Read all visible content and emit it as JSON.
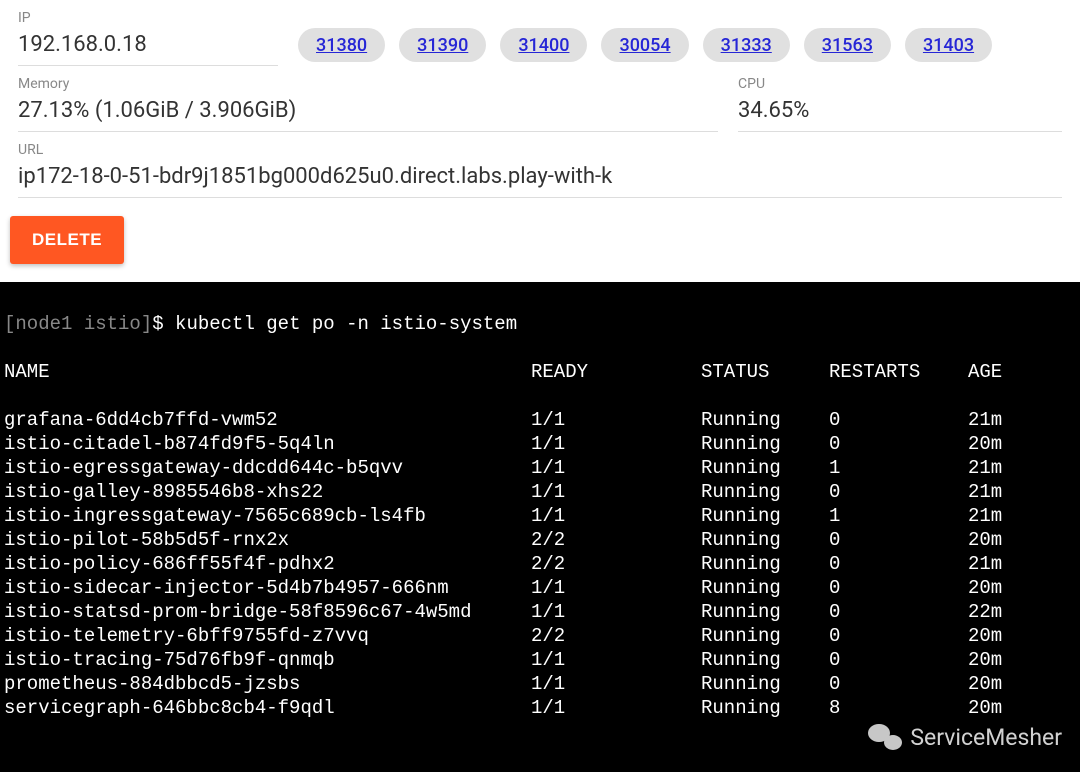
{
  "info": {
    "ip_label": "IP",
    "ip_value": "192.168.0.18",
    "ports": [
      "31380",
      "31390",
      "31400",
      "30054",
      "31333",
      "31563",
      "31403"
    ],
    "memory_label": "Memory",
    "memory_value": "27.13% (1.06GiB / 3.906GiB)",
    "cpu_label": "CPU",
    "cpu_value": "34.65%",
    "url_label": "URL",
    "url_value": "ip172-18-0-51-bdr9j1851bg000d625u0.direct.labs.play-with-k",
    "delete_label": "DELETE"
  },
  "terminal": {
    "prompt_prefix": "[node1 istio]",
    "prompt_symbol": "$",
    "command": "kubectl get po -n istio-system",
    "headers": {
      "name": "NAME",
      "ready": "READY",
      "status": "STATUS",
      "restarts": "RESTARTS",
      "age": "AGE"
    },
    "rows": [
      {
        "name": "grafana-6dd4cb7ffd-vwm52",
        "ready": "1/1",
        "status": "Running",
        "restarts": "0",
        "age": "21m"
      },
      {
        "name": "istio-citadel-b874fd9f5-5q4ln",
        "ready": "1/1",
        "status": "Running",
        "restarts": "0",
        "age": "20m"
      },
      {
        "name": "istio-egressgateway-ddcdd644c-b5qvv",
        "ready": "1/1",
        "status": "Running",
        "restarts": "1",
        "age": "21m"
      },
      {
        "name": "istio-galley-8985546b8-xhs22",
        "ready": "1/1",
        "status": "Running",
        "restarts": "0",
        "age": "21m"
      },
      {
        "name": "istio-ingressgateway-7565c689cb-ls4fb",
        "ready": "1/1",
        "status": "Running",
        "restarts": "1",
        "age": "21m"
      },
      {
        "name": "istio-pilot-58b5d5f-rnx2x",
        "ready": "2/2",
        "status": "Running",
        "restarts": "0",
        "age": "20m"
      },
      {
        "name": "istio-policy-686ff55f4f-pdhx2",
        "ready": "2/2",
        "status": "Running",
        "restarts": "0",
        "age": "21m"
      },
      {
        "name": "istio-sidecar-injector-5d4b7b4957-666nm",
        "ready": "1/1",
        "status": "Running",
        "restarts": "0",
        "age": "20m"
      },
      {
        "name": "istio-statsd-prom-bridge-58f8596c67-4w5md",
        "ready": "1/1",
        "status": "Running",
        "restarts": "0",
        "age": "22m"
      },
      {
        "name": "istio-telemetry-6bff9755fd-z7vvq",
        "ready": "2/2",
        "status": "Running",
        "restarts": "0",
        "age": "20m"
      },
      {
        "name": "istio-tracing-75d76fb9f-qnmqb",
        "ready": "1/1",
        "status": "Running",
        "restarts": "0",
        "age": "20m"
      },
      {
        "name": "prometheus-884dbbcd5-jzsbs",
        "ready": "1/1",
        "status": "Running",
        "restarts": "0",
        "age": "20m"
      },
      {
        "name": "servicegraph-646bbc8cb4-f9qdl",
        "ready": "1/1",
        "status": "Running",
        "restarts": "8",
        "age": "20m"
      }
    ]
  },
  "watermark": {
    "text": "ServiceMesher"
  }
}
